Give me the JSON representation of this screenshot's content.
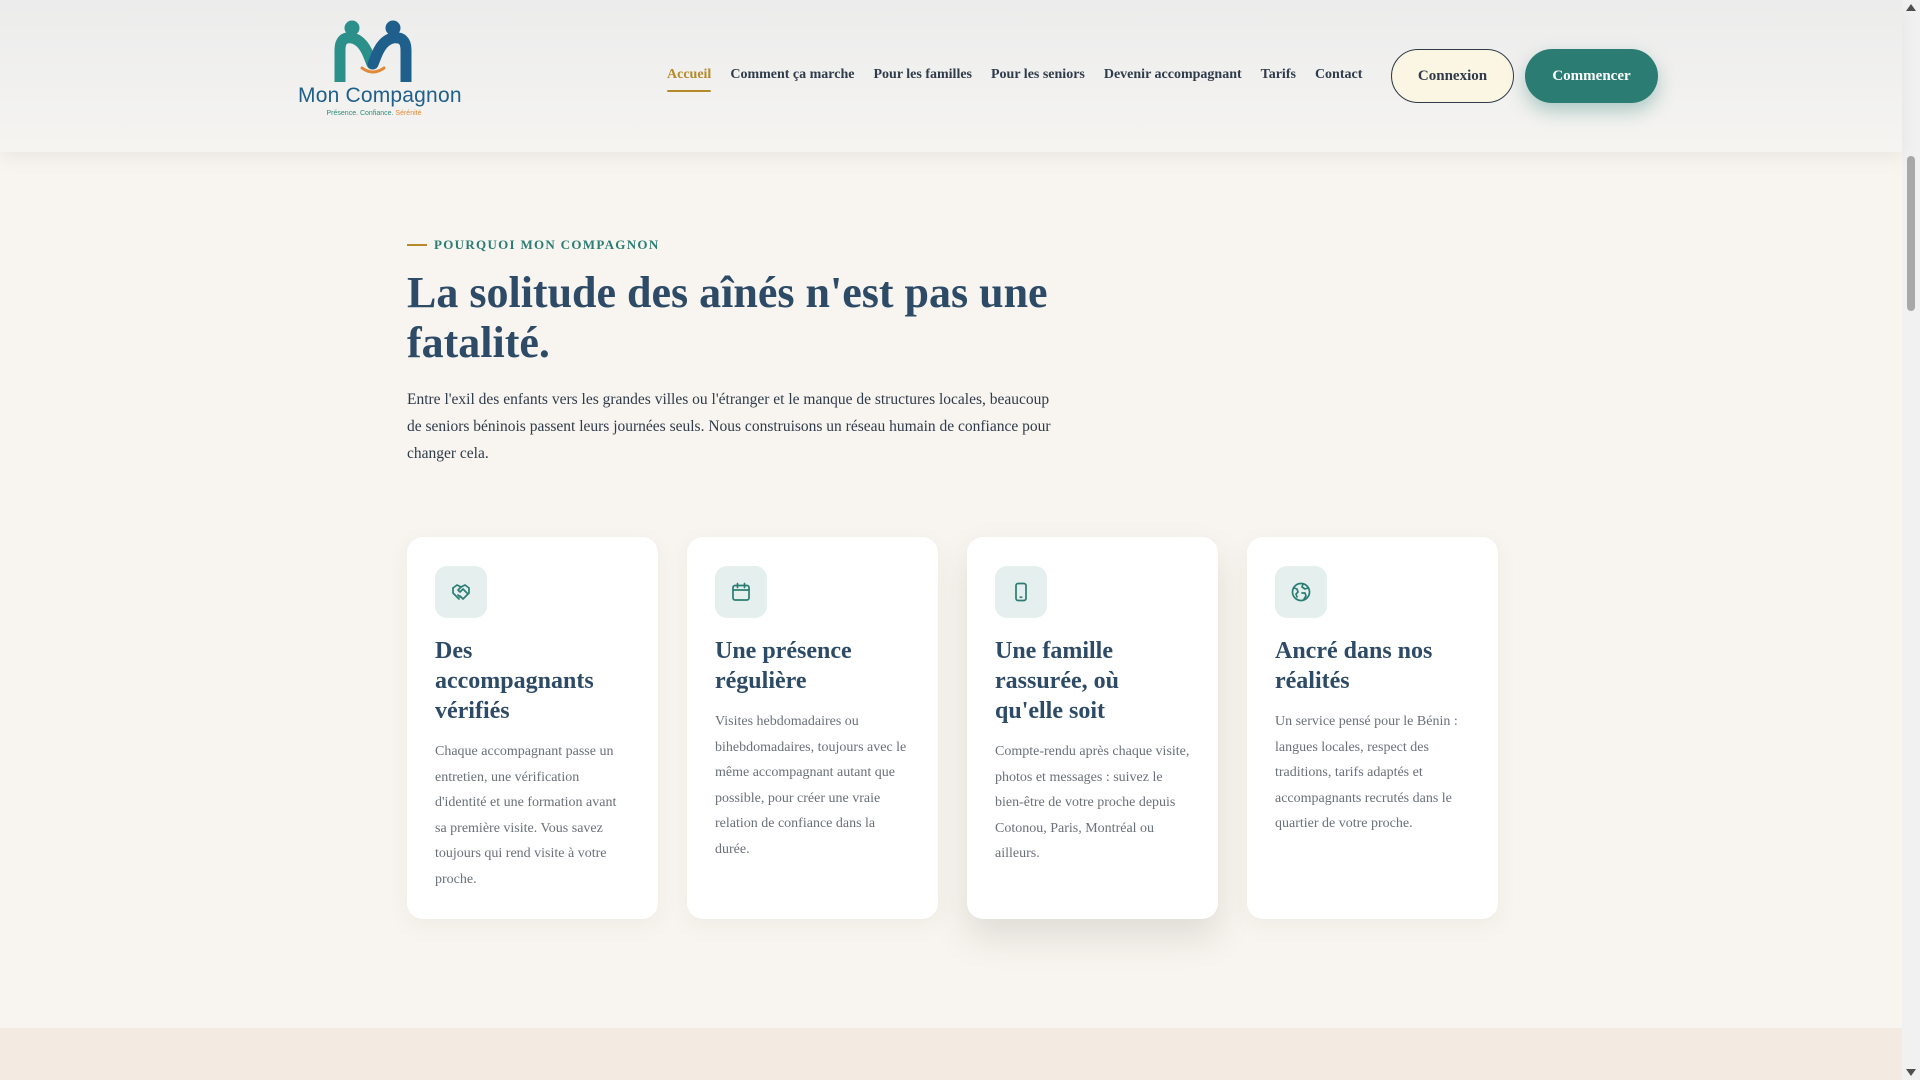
{
  "header": {
    "logo": {
      "name": "Mon Compagnon",
      "tagline_main": "Présence. Confiance.",
      "tagline_accent": "Sérénité"
    },
    "nav": [
      {
        "label": "Accueil",
        "active": true
      },
      {
        "label": "Comment ça marche",
        "active": false
      },
      {
        "label": "Pour les familles",
        "active": false
      },
      {
        "label": "Pour les seniors",
        "active": false
      },
      {
        "label": "Devenir accompagnant",
        "active": false
      },
      {
        "label": "Tarifs",
        "active": false
      },
      {
        "label": "Contact",
        "active": false
      }
    ],
    "login_label": "Connexion",
    "cta_label": "Commencer"
  },
  "section": {
    "eyebrow": "POURQUOI MON COMPAGNON",
    "title": "La solitude des aînés n'est pas une fatalité.",
    "lead": "Entre l'exil des enfants vers les grandes villes ou l'étranger et le manque de structures locales, beaucoup de seniors béninois passent leurs journées seuls. Nous construisons un réseau humain de confiance pour changer cela.",
    "cards": [
      {
        "icon": "handshake-icon",
        "title": "Des accompagnants vérifiés",
        "text": "Chaque accompagnant passe un entretien, une vérification d'identité et une formation avant sa première visite. Vous savez toujours qui rend visite à votre proche."
      },
      {
        "icon": "calendar-icon",
        "title": "Une présence régulière",
        "text": "Visites hebdomadaires ou bihebdomadaires, toujours avec le même accompagnant autant que possible, pour créer une vraie relation de confiance dans la durée."
      },
      {
        "icon": "smartphone-icon",
        "title": "Une famille rassurée, où qu'elle soit",
        "text": "Compte-rendu après chaque visite, photos et messages : suivez le bien-être de votre proche depuis Cotonou, Paris, Montréal ou ailleurs."
      },
      {
        "icon": "globe-icon",
        "title": "Ancré dans nos réalités",
        "text": "Un service pensé pour le Bénin : langues locales, respect des traditions, tarifs adaptés et accompagnants recrutés dans le quartier de votre proche."
      }
    ]
  },
  "colors": {
    "primary": "#2b7d73",
    "accent": "#b58a28",
    "heading": "#2d4a66",
    "background": "#f8f5f0"
  }
}
